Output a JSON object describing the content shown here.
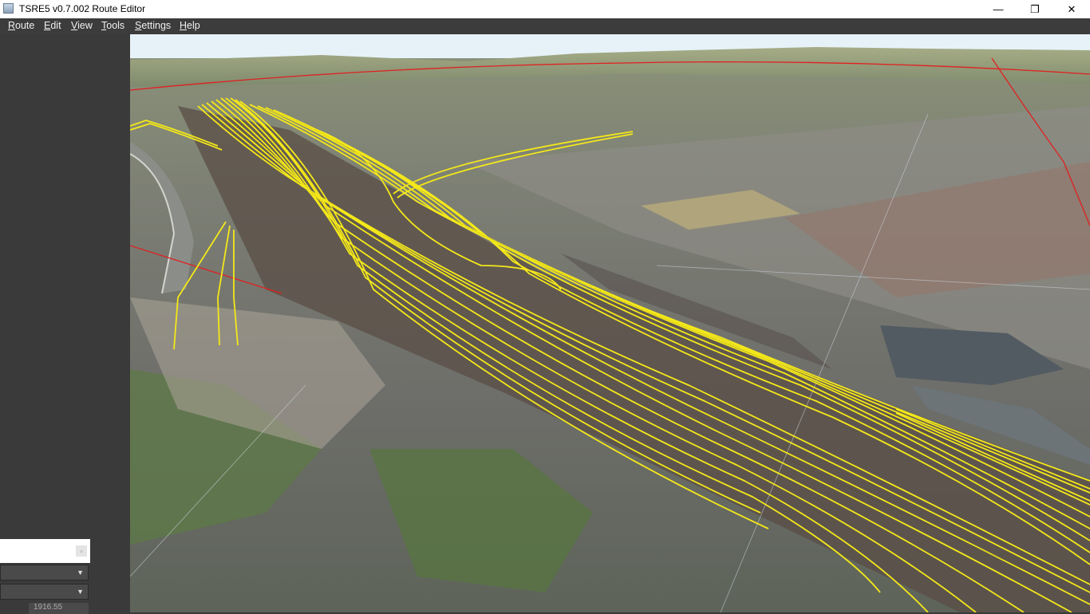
{
  "window": {
    "title": "TSRE5 v0.7.002 Route Editor",
    "minimize_glyph": "—",
    "maximize_glyph": "❐",
    "close_glyph": "✕"
  },
  "menu": [
    {
      "pre": "",
      "ul": "R",
      "post": "oute"
    },
    {
      "pre": "",
      "ul": "E",
      "post": "dit"
    },
    {
      "pre": "",
      "ul": "V",
      "post": "iew"
    },
    {
      "pre": "",
      "ul": "T",
      "post": "ools"
    },
    {
      "pre": "",
      "ul": "S",
      "post": "ettings"
    },
    {
      "pre": "",
      "ul": "H",
      "post": "elp"
    }
  ],
  "left_panel": {
    "field_value": "1916.55"
  },
  "viewport": {
    "track_color": "#f4e81a",
    "boundary_color": "#e02020",
    "sky_color": "#e6f2f8"
  }
}
